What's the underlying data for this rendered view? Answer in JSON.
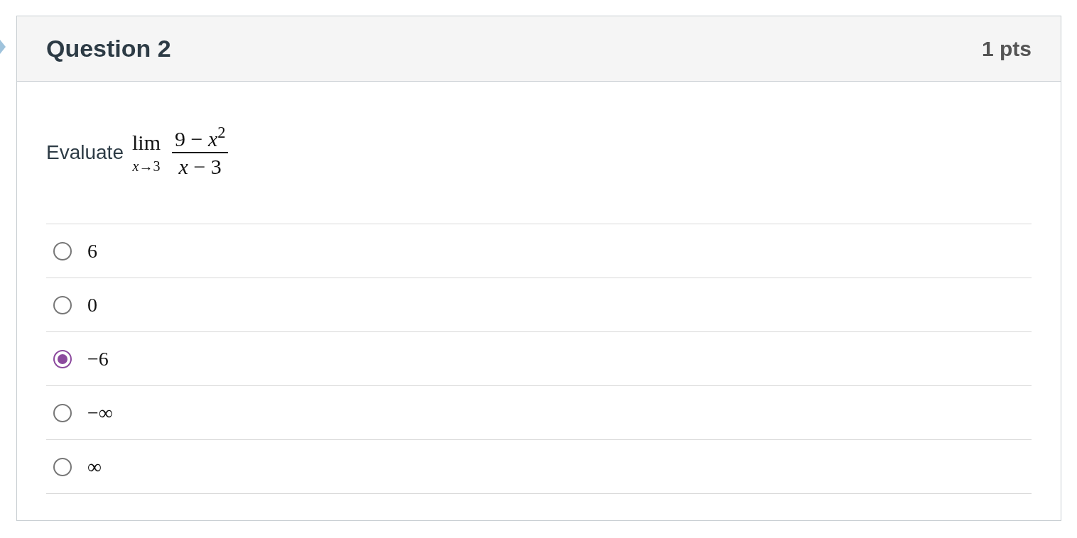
{
  "question": {
    "title": "Question 2",
    "points": "1 pts",
    "prompt": "Evaluate",
    "math": {
      "operator": "lim",
      "subscript": "*x*→3",
      "numerator": "9 − *x*$^{2}$",
      "denominator": "*x* − 3"
    }
  },
  "answers": [
    {
      "label": "6",
      "selected": false
    },
    {
      "label": "0",
      "selected": false
    },
    {
      "label": "−6",
      "selected": true
    },
    {
      "label": "−∞",
      "selected": false
    },
    {
      "label": "∞",
      "selected": false
    }
  ]
}
